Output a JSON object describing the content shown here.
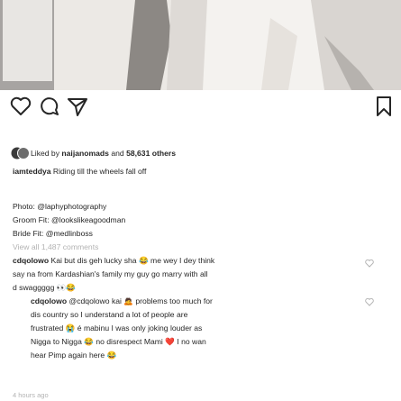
{
  "post": {
    "likes_prefix": "Liked by",
    "liked_by_user": "naijanomads",
    "likes_mid": "and",
    "likes_count": "58,631 others",
    "caption_user": "iamteddya",
    "caption_text": "Riding till the wheels fall off",
    "credits": [
      "Photo: @laphyphotography",
      "Groom Fit: @lookslikeagoodman",
      "Bride Fit: @medlinboss"
    ],
    "view_comments": "View all 1,487 comments",
    "time_ago": "4 hours ago"
  },
  "comments": [
    {
      "user": "cdqolowo",
      "lines": [
        "Kai but dis geh lucky sha 😂 me wey I dey think",
        "say na from Kardashian's family my guy go marry with all",
        "d swaggggg 👀😂"
      ]
    }
  ],
  "reply": {
    "user": "cdqolowo",
    "mention": "@cdqolowo",
    "lines": [
      "kai 🙇 problems too much for",
      "dis country so I understand a lot of people are",
      "frustrated 😭 é mabinu I was only joking louder as",
      "Nigga to Nigga 😂 no disrespect Mami ❤️ I no wan",
      "hear Pimp again here 😂"
    ]
  },
  "icons": {
    "like": "heart-icon",
    "comment": "comment-icon",
    "share": "share-icon",
    "save": "bookmark-icon"
  },
  "colors": {
    "text": "#262626",
    "muted": "#b3b3b3"
  }
}
